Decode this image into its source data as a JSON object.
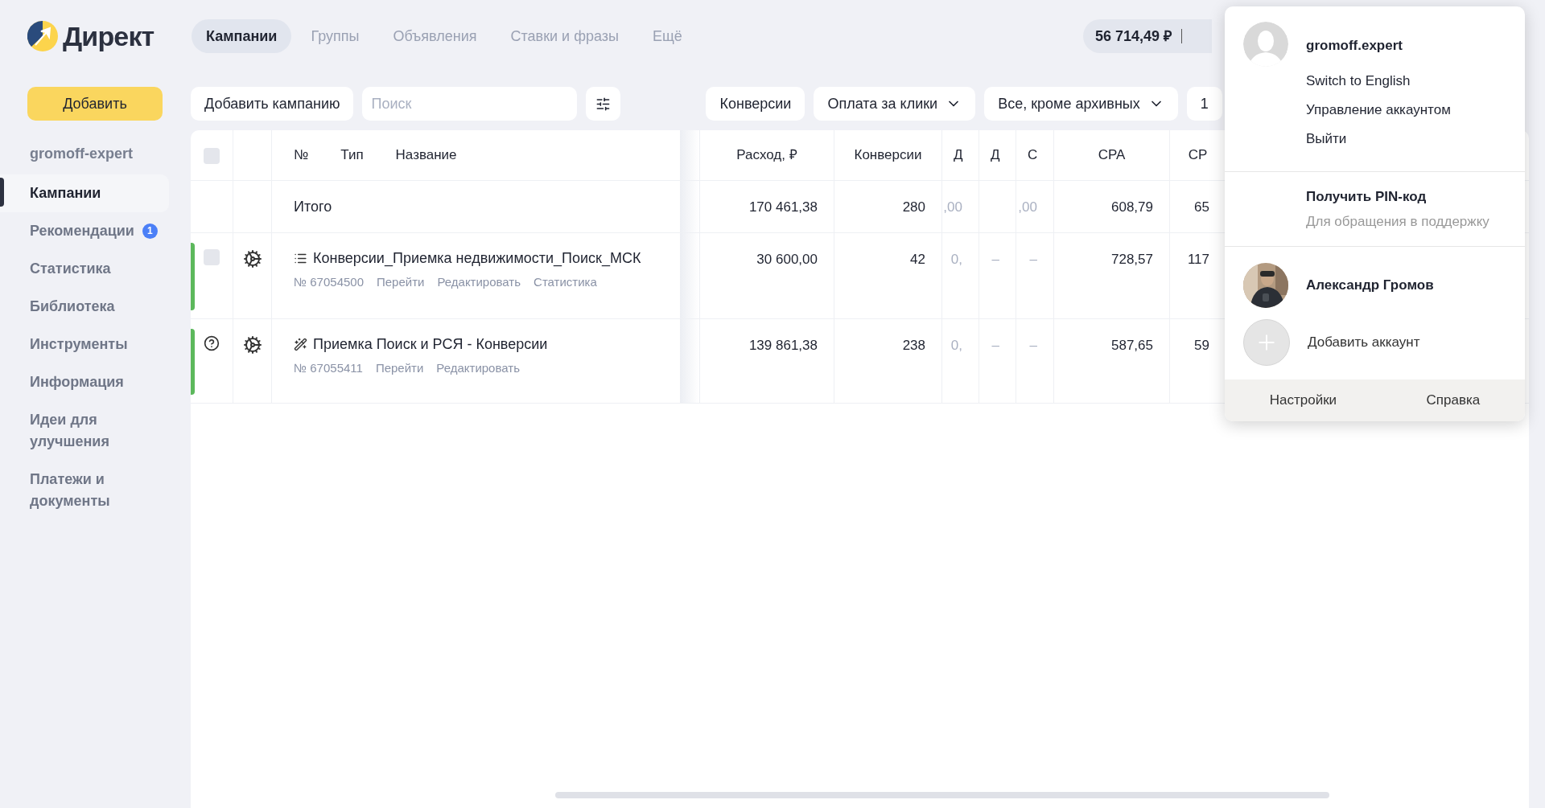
{
  "logo": {
    "text": "Директ"
  },
  "nav_tabs": [
    {
      "label": "Кампании",
      "selected": true
    },
    {
      "label": "Группы",
      "selected": false
    },
    {
      "label": "Объявления",
      "selected": false
    },
    {
      "label": "Ставки и фразы",
      "selected": false
    },
    {
      "label": "Ещё",
      "selected": false
    }
  ],
  "balance": {
    "amount": "56 714,49 ₽"
  },
  "add_button": "Добавить",
  "sidebar": {
    "account": "gromoff-expert",
    "items": [
      {
        "label": "Кампании",
        "selected": true
      },
      {
        "label": "Рекомендации",
        "selected": false,
        "badge": "1"
      },
      {
        "label": "Статистика",
        "selected": false
      },
      {
        "label": "Библиотека",
        "selected": false
      },
      {
        "label": "Инструменты",
        "selected": false
      },
      {
        "label": "Информация",
        "selected": false
      },
      {
        "label": "Идеи для улучшения",
        "selected": false
      },
      {
        "label": "Платежи и документы",
        "selected": false
      }
    ]
  },
  "toolbar": {
    "add_campaign": "Добавить кампанию",
    "search": {
      "placeholder": "Поиск"
    },
    "filters": [
      {
        "label": "Конверсии",
        "dropdown": false
      },
      {
        "label": "Оплата за клики",
        "dropdown": true
      },
      {
        "label": "Все, кроме архивных",
        "dropdown": true
      },
      {
        "label": "1",
        "dropdown": false
      }
    ]
  },
  "table": {
    "name_columns": [
      "№",
      "Тип",
      "Название"
    ],
    "columns": [
      "Расход, ₽",
      "Конверсии",
      "Д",
      "Д",
      "С",
      "CPA",
      "CP"
    ],
    "select_all": {
      "checked": false
    },
    "total": {
      "label": "Итого",
      "values": [
        {
          "kind": "value",
          "text": "170 461,38"
        },
        {
          "kind": "value",
          "text": "280"
        },
        {
          "kind": "value",
          "text": ",00"
        },
        {
          "kind": "empty"
        },
        {
          "kind": "value",
          "text": ",00"
        },
        {
          "kind": "value",
          "text": "608,79"
        },
        {
          "kind": "value",
          "text": "65"
        }
      ]
    },
    "rows": [
      {
        "kind": "checkbox",
        "checked": false,
        "campaign": {
          "kind": "list",
          "name": "Конверсии_Приемка недвижимости_Поиск_МСК"
        },
        "number": "№ 67054500",
        "links": [
          "Перейти",
          "Редактировать",
          "Статистика"
        ],
        "values": [
          "30 600,00",
          "42",
          "0,",
          "–",
          "–",
          "728,57",
          "117"
        ]
      },
      {
        "kind": "help",
        "campaign": {
          "kind": "wand",
          "name": "Приемка Поиск и РСЯ - Конверсии"
        },
        "number": "№ 67055411",
        "links": [
          "Перейти",
          "Редактировать"
        ],
        "values": [
          "139 861,38",
          "238",
          "0,",
          "–",
          "–",
          "587,65",
          "59"
        ]
      }
    ]
  },
  "account_menu": {
    "user": "gromoff.expert",
    "items": [
      "Switch to English",
      "Управление аккаунтом",
      "Выйти"
    ],
    "pin": {
      "title": "Получить PIN-код",
      "subtitle": "Для обращения в поддержку"
    },
    "accounts": [
      {
        "name": "Александр Громов",
        "kind": "picture"
      }
    ],
    "add_account": "Добавить аккаунт",
    "footer": [
      "Настройки",
      "Справка"
    ]
  }
}
